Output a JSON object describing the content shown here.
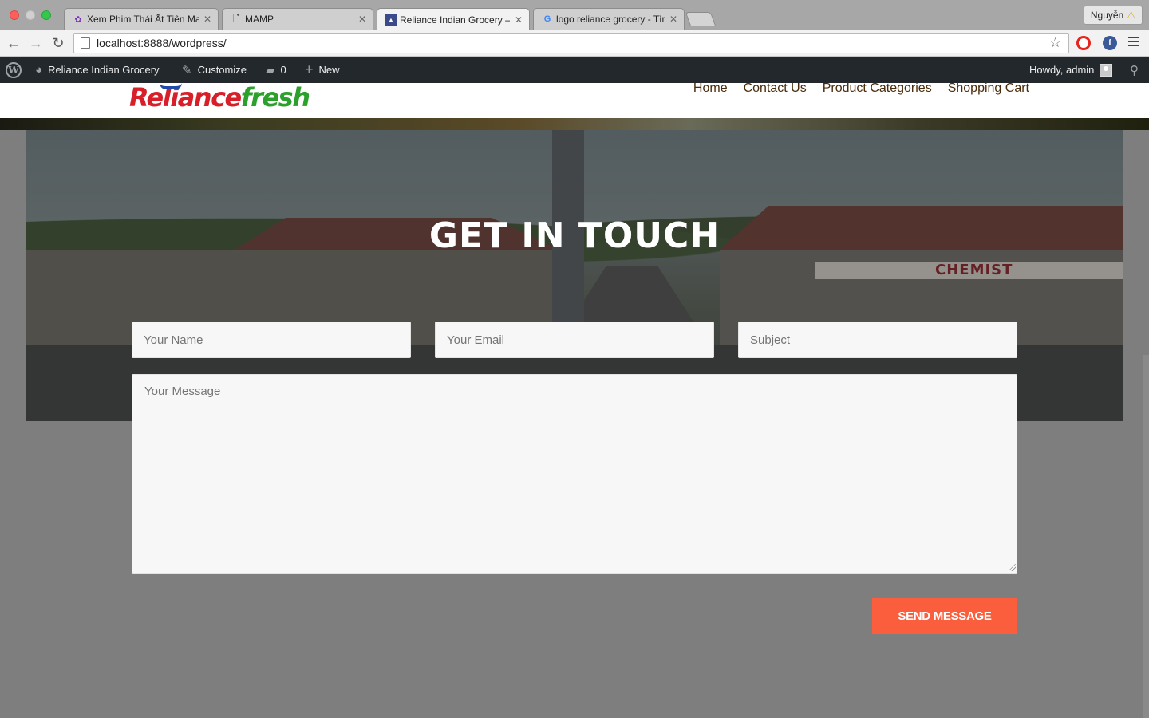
{
  "browser": {
    "tabs": [
      {
        "title": "Xem Phim Thái Ất Tiên Ma",
        "favicon": "film-reel-icon"
      },
      {
        "title": "MAMP",
        "favicon": "document-icon"
      },
      {
        "title": "Reliance Indian Grocery – E",
        "favicon": "site-icon"
      },
      {
        "title": "logo reliance grocery - Tìm",
        "favicon": "google-icon"
      }
    ],
    "active_tab": 2,
    "profile_name": "Nguyễn",
    "url": "localhost:8888/wordpress/"
  },
  "adminbar": {
    "site_name": "Reliance Indian Grocery",
    "customize": "Customize",
    "comments_count": "0",
    "new_label": "New",
    "greeting": "Howdy, admin"
  },
  "site": {
    "logo_part1": "Reliance",
    "logo_part2": "fresh",
    "nav": [
      "Home",
      "Contact Us",
      "Product Categories",
      "Shopping Cart"
    ]
  },
  "hero": {
    "title": "GET IN TOUCH",
    "sign_text": "CHEMIST"
  },
  "form": {
    "name_placeholder": "Your Name",
    "email_placeholder": "Your Email",
    "subject_placeholder": "Subject",
    "message_placeholder": "Your Message",
    "submit_label": "SEND MESSAGE"
  },
  "colors": {
    "accent": "#fa5e3d",
    "adminbar": "#23282d",
    "logo_red": "#d81e28",
    "logo_green": "#2ba02b"
  }
}
